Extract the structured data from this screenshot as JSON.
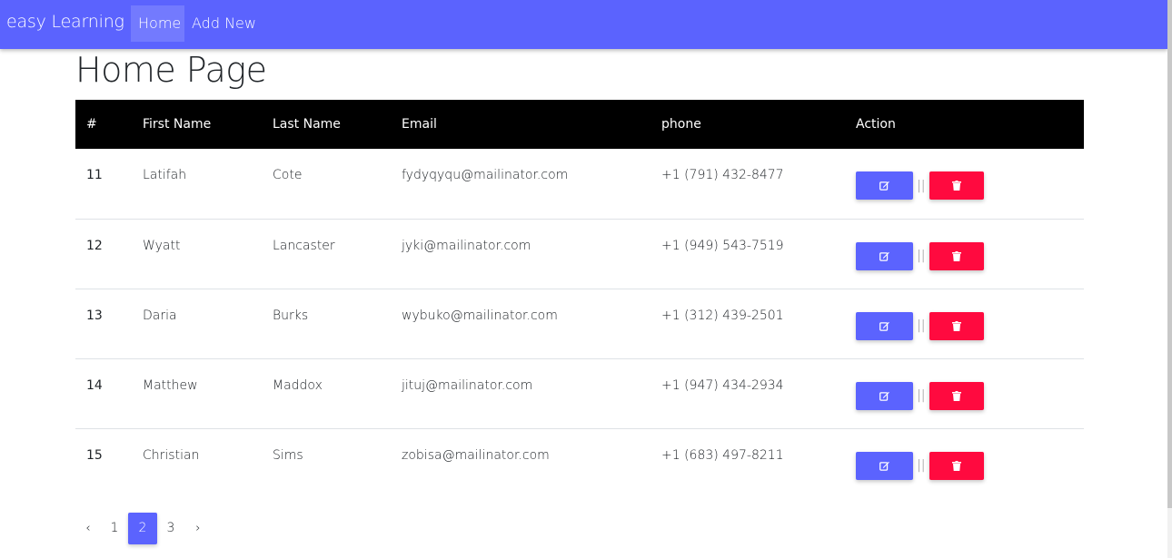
{
  "nav": {
    "brand": "easy Learning",
    "links": [
      "Home",
      "Add New"
    ]
  },
  "page": {
    "title": "Home Page"
  },
  "table": {
    "headers": [
      "#",
      "First Name",
      "Last Name",
      "Email",
      "phone",
      "Action"
    ],
    "rows": [
      {
        "id": "11",
        "first": "Latifah",
        "last": "Cote",
        "email": "fydyqyqu@mailinator.com",
        "phone": "+1 (791) 432-8477"
      },
      {
        "id": "12",
        "first": "Wyatt",
        "last": "Lancaster",
        "email": "jyki@mailinator.com",
        "phone": "+1 (949) 543-7519"
      },
      {
        "id": "13",
        "first": "Daria",
        "last": "Burks",
        "email": "wybuko@mailinator.com",
        "phone": "+1 (312) 439-2501"
      },
      {
        "id": "14",
        "first": "Matthew",
        "last": "Maddox",
        "email": "jituj@mailinator.com",
        "phone": "+1 (947) 434-2934"
      },
      {
        "id": "15",
        "first": "Christian",
        "last": "Sims",
        "email": "zobisa@mailinator.com",
        "phone": "+1 (683) 497-8211"
      }
    ],
    "action_separator": "||",
    "edit_icon": "edit-icon",
    "delete_icon": "trash-icon"
  },
  "pagination": {
    "prev": "‹",
    "pages": [
      "1",
      "2",
      "3"
    ],
    "current": "2",
    "next": "›"
  },
  "colors": {
    "primary": "#5b63fe",
    "danger": "#ff0a3f",
    "header_bg": "#000000"
  }
}
